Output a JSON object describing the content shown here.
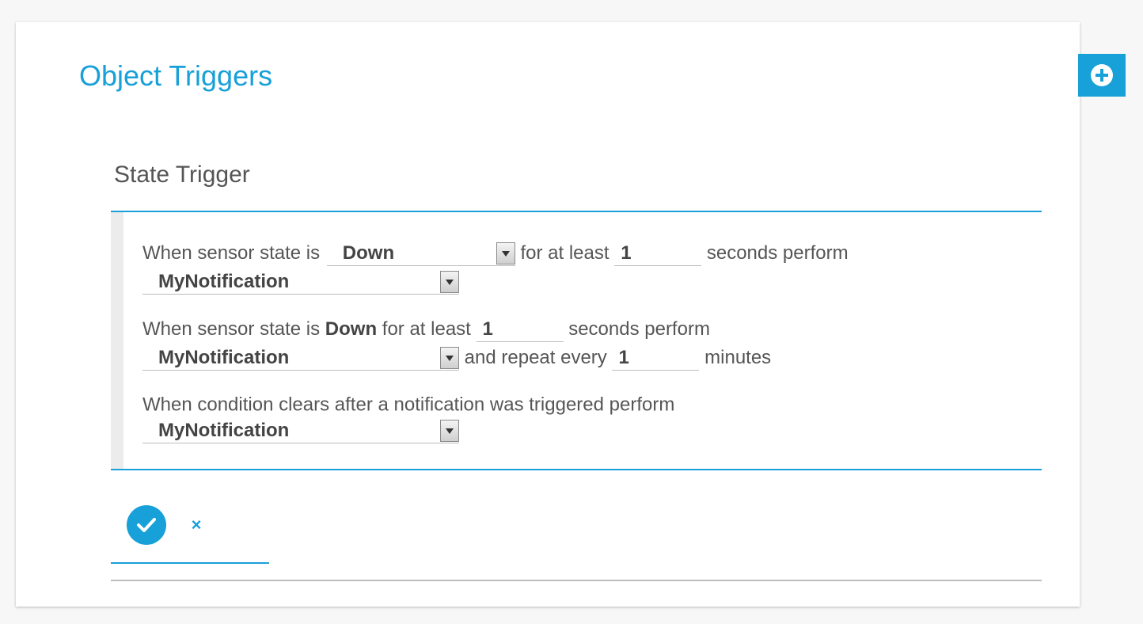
{
  "header": {
    "title": "Object Triggers"
  },
  "icons": {
    "add": "plus-circle-icon",
    "confirm": "check-icon",
    "cancel": "close-icon"
  },
  "colors": {
    "accent": "#18a0d8",
    "divider": "#bdbdbd"
  },
  "trigger": {
    "title": "State Trigger",
    "row1": {
      "prefix": "When sensor state is",
      "state_value": "Down",
      "mid": "for at least",
      "seconds_value": "1",
      "suffix": "seconds perform",
      "notification_value": "MyNotification"
    },
    "row2": {
      "prefix": "When sensor state is",
      "state_text": "Down",
      "mid": "for at least",
      "seconds_value": "1",
      "suffix": "seconds perform",
      "notification_value": "MyNotification",
      "repeat_label": "and repeat every",
      "repeat_value": "1",
      "repeat_unit": "minutes"
    },
    "row3": {
      "text": "When condition clears after a notification was triggered perform",
      "notification_value": "MyNotification"
    }
  },
  "actions": {
    "cancel_glyph": "×"
  }
}
